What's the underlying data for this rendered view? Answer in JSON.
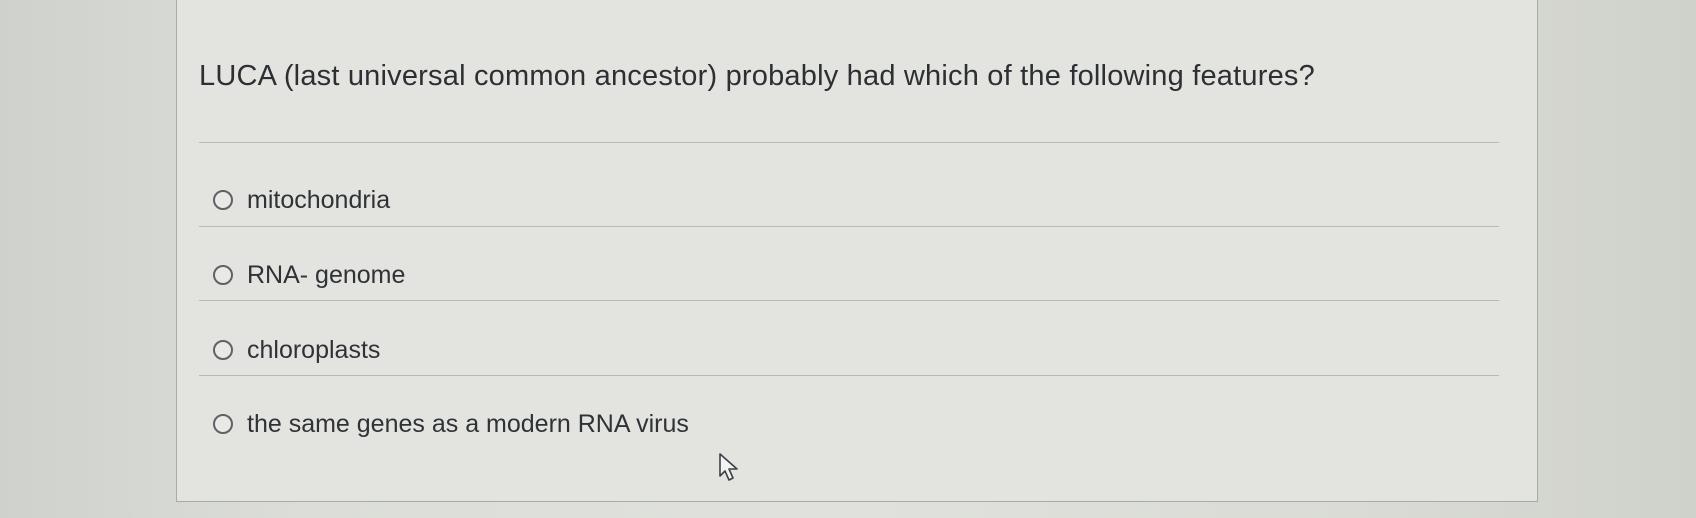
{
  "question": {
    "text": "LUCA (last universal common ancestor) probably had which of the following features?"
  },
  "options": [
    {
      "label": "mitochondria",
      "selected": false
    },
    {
      "label": "RNA- genome",
      "selected": false
    },
    {
      "label": "chloroplasts",
      "selected": false
    },
    {
      "label": "the same genes as a modern RNA virus",
      "selected": false
    }
  ],
  "cursor": {
    "icon": "mouse-pointer-icon"
  }
}
